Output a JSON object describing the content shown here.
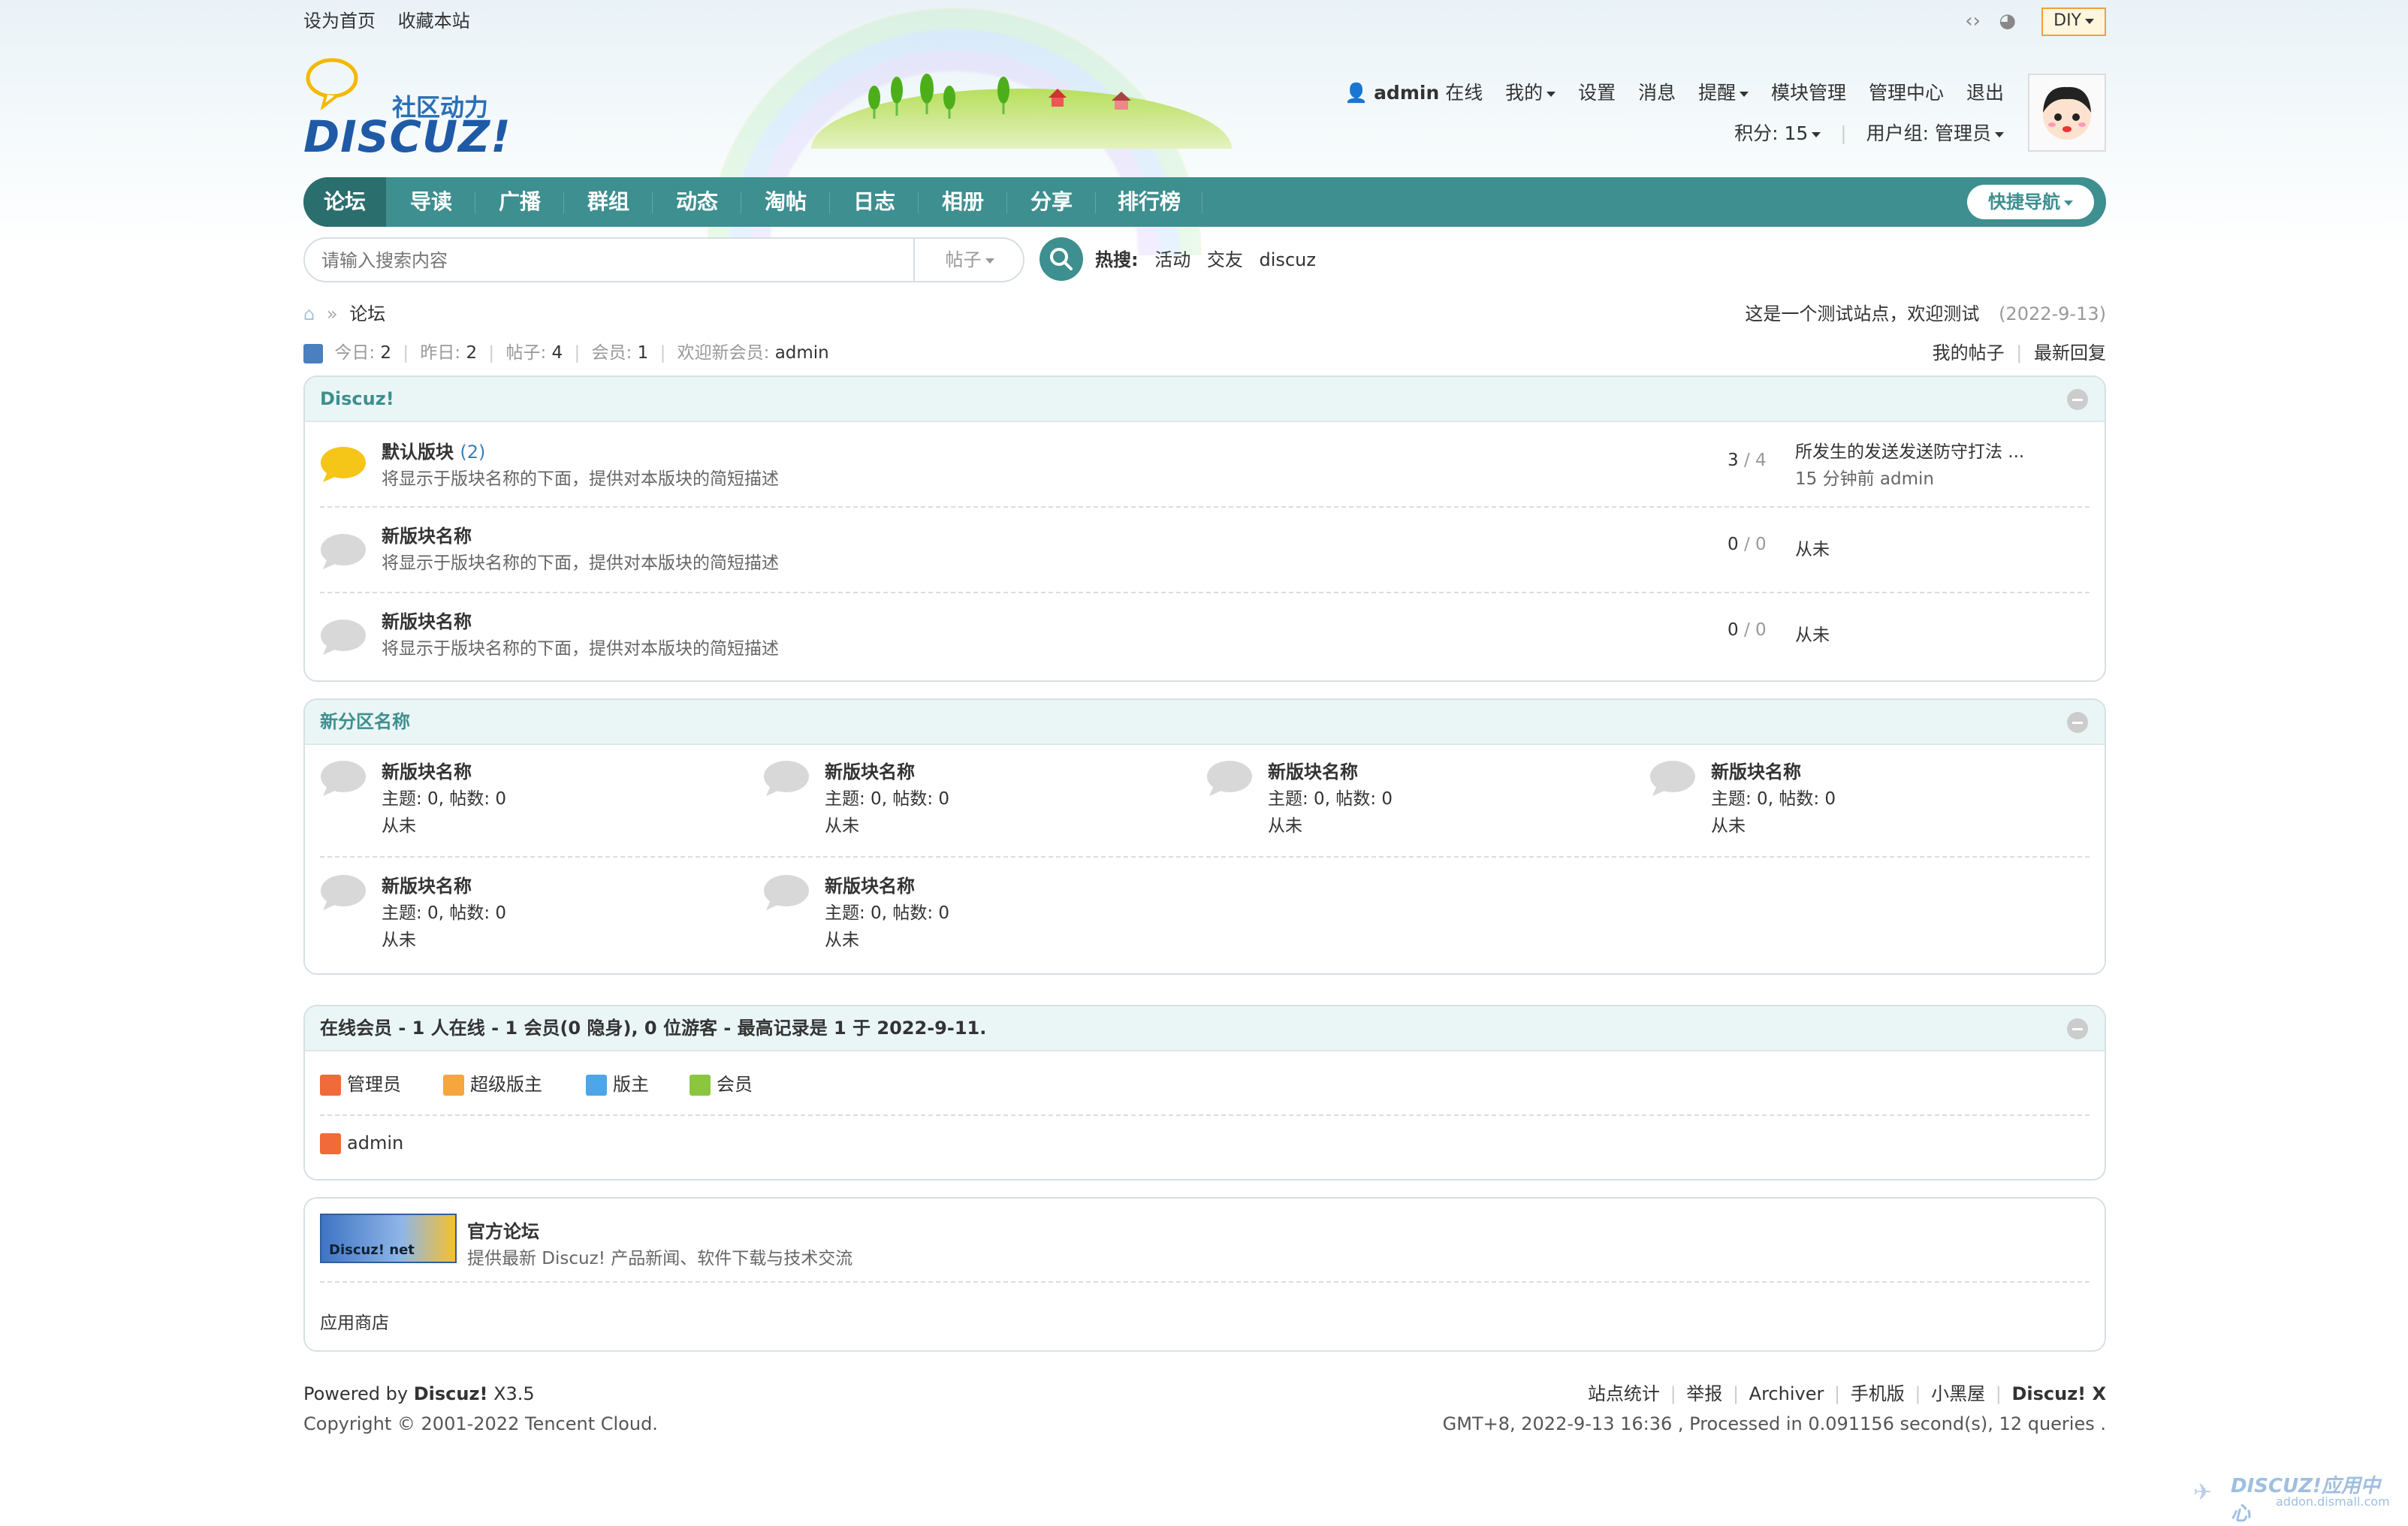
{
  "topbar": {
    "set_home": "设为首页",
    "bookmark": "收藏本站",
    "diy": "DIY"
  },
  "logo": {
    "tag": "社区动力",
    "brand": "DISCUZ!"
  },
  "user": {
    "name": "admin",
    "status": "在线",
    "my": "我的",
    "settings": "设置",
    "messages": "消息",
    "remind": "提醒",
    "blocks": "模块管理",
    "admin_center": "管理中心",
    "logout": "退出",
    "points": "积分: 15",
    "group": "用户组: 管理员"
  },
  "nav": {
    "items": [
      "论坛",
      "导读",
      "广播",
      "群组",
      "动态",
      "淘帖",
      "日志",
      "相册",
      "分享",
      "排行榜"
    ],
    "quick": "快捷导航"
  },
  "search": {
    "placeholder": "请输入搜索内容",
    "type": "帖子",
    "hot_label": "热搜:",
    "hot": [
      "活动",
      "交友",
      "discuz"
    ]
  },
  "crumb": {
    "current": "论坛"
  },
  "notice": {
    "text": "这是一个测试站点，欢迎测试",
    "date": "(2022-9-13)"
  },
  "stats": {
    "today_label": "今日:",
    "today": "2",
    "yesterday_label": "昨日:",
    "yesterday": "2",
    "posts_label": "帖子:",
    "posts": "4",
    "members_label": "会员:",
    "members": "1",
    "welcome_label": "欢迎新会员:",
    "welcome": "admin",
    "my_posts": "我的帖子",
    "latest": "最新回复"
  },
  "cat1": {
    "title": "Discuz!",
    "forums": [
      {
        "name": "默认版块",
        "today": "(2)",
        "desc": "将显示于版块名称的下面，提供对本版块的简短描述",
        "threads": "3",
        "posts": "4",
        "last_title": "所发生的发送发送防守打法 ...",
        "last_time": "15 分钟前 admin"
      },
      {
        "name": "新版块名称",
        "desc": "将显示于版块名称的下面，提供对本版块的简短描述",
        "threads": "0",
        "posts": "0",
        "last": "从未"
      },
      {
        "name": "新版块名称",
        "desc": "将显示于版块名称的下面，提供对本版块的简短描述",
        "threads": "0",
        "posts": "0",
        "last": "从未"
      }
    ],
    "sep": "/"
  },
  "cat2": {
    "title": "新分区名称",
    "forums": [
      {
        "name": "新版块名称",
        "stats": "主题: 0, 帖数: 0",
        "last": "从未"
      },
      {
        "name": "新版块名称",
        "stats": "主题: 0, 帖数: 0",
        "last": "从未"
      },
      {
        "name": "新版块名称",
        "stats": "主题: 0, 帖数: 0",
        "last": "从未"
      },
      {
        "name": "新版块名称",
        "stats": "主题: 0, 帖数: 0",
        "last": "从未"
      },
      {
        "name": "新版块名称",
        "stats": "主题: 0, 帖数: 0",
        "last": "从未"
      },
      {
        "name": "新版块名称",
        "stats": "主题: 0, 帖数: 0",
        "last": "从未"
      }
    ]
  },
  "online": {
    "title": "在线会员 - 1 人在线 - 1 会员(0 隐身), 0 位游客 - 最高记录是 1 于 2022-9-11.",
    "legend": [
      "管理员",
      "超级版主",
      "版主",
      "会员"
    ],
    "users": [
      "admin"
    ]
  },
  "links": {
    "name": "官方论坛",
    "desc": "提供最新 Discuz! 产品新闻、软件下载与技术交流",
    "banner": "Discuz! net",
    "store": "应用商店"
  },
  "footer": {
    "powered": "Powered by",
    "brand": "Discuz!",
    "version": "X3.5",
    "copyright": "Copyright © 2001-2022 Tencent Cloud.",
    "links": [
      "站点统计",
      "举报",
      "Archiver",
      "手机版",
      "小黑屋"
    ],
    "brand_x": "Discuz! X",
    "info": "GMT+8, 2022-9-13 16:36 , Processed in 0.091156 second(s), 12 queries ."
  },
  "watermark": {
    "brand": "DISCUZ!应用中心",
    "url": "addon.dismall.com"
  },
  "colors": {
    "accent": "#3e8f8f",
    "forum_active": "#f5c518",
    "forum_idle": "#d8d8d8"
  }
}
